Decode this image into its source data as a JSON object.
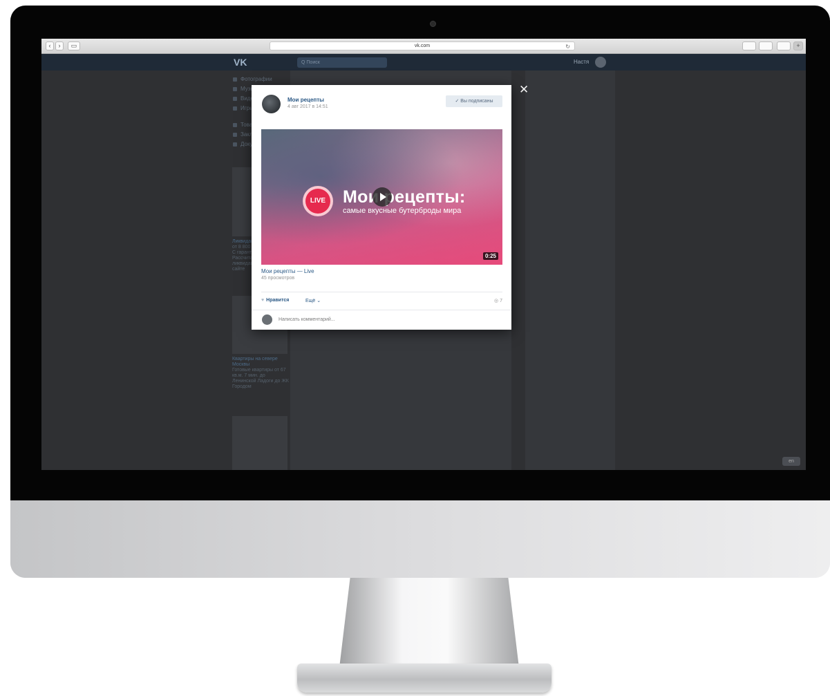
{
  "browser": {
    "url": "vk.com",
    "reload_glyph": "↻",
    "back_glyph": "‹",
    "forward_glyph": "›",
    "sidebar_glyph": "▭"
  },
  "vk": {
    "header": {
      "logo": "VK",
      "search_placeholder": "Q Поиск",
      "user_name": "Настя"
    },
    "left_menu": [
      "Фотографии",
      "Музыка",
      "Видео",
      "Игры",
      "Товары",
      "Закладки",
      "Документы"
    ],
    "ad1": {
      "title": "Ликвидация ООО",
      "price": "от 8 800 руб.",
      "text": "С гарантией без долгов. Рассчитайте стоимость ликвидации прямо на сайте"
    },
    "ad2": {
      "title": "Квартиры на севере Москвы",
      "text": "Готовые квартиры от 67 кв.м. 7 мин. до Ленинской Ладоги до ЖК Городом"
    },
    "corner_badge": "en"
  },
  "modal": {
    "group_name": "Мои рецепты",
    "date": "4 авг 2017 в 14:51",
    "subscribed_label": "✓ Вы подписаны",
    "video": {
      "live_badge": "LIVE",
      "title": "Мои рецепты:",
      "subtitle": "самые вкусные бутерброды мира",
      "duration": "0:25"
    },
    "video_title": "Мои рецепты — Live",
    "views": "45 просмотров",
    "like_label": "Нравится",
    "more_label": "Ещё ⌄",
    "views_count": "◎ 7",
    "comment_placeholder": "Написать комментарий...",
    "close_glyph": "✕"
  }
}
